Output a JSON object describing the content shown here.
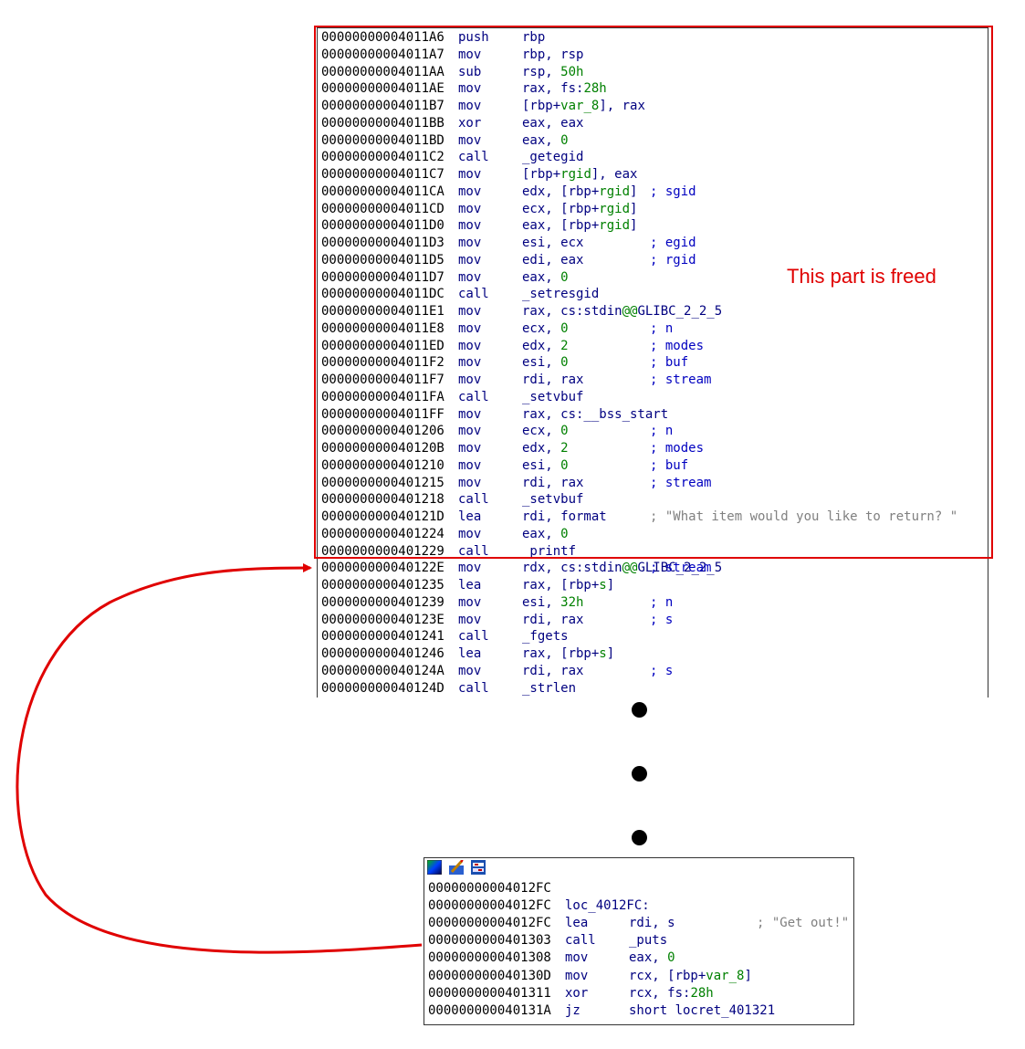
{
  "annotation": {
    "label": "This part is freed",
    "color": "#e00000"
  },
  "main_listing": [
    {
      "addr": "00000000004011A6",
      "mn": "push",
      "op": [
        {
          "t": "rbp"
        }
      ],
      "cm": ""
    },
    {
      "addr": "00000000004011A7",
      "mn": "mov",
      "op": [
        {
          "t": "rbp, rsp"
        }
      ],
      "cm": ""
    },
    {
      "addr": "00000000004011AA",
      "mn": "sub",
      "op": [
        {
          "t": "rsp, "
        },
        {
          "t": "50h",
          "c": "num"
        }
      ],
      "cm": ""
    },
    {
      "addr": "00000000004011AE",
      "mn": "mov",
      "op": [
        {
          "t": "rax, fs:"
        },
        {
          "t": "28h",
          "c": "num"
        }
      ],
      "cm": ""
    },
    {
      "addr": "00000000004011B7",
      "mn": "mov",
      "op": [
        {
          "t": "[rbp+"
        },
        {
          "t": "var_8",
          "c": "var"
        },
        {
          "t": "], rax"
        }
      ],
      "cm": ""
    },
    {
      "addr": "00000000004011BB",
      "mn": "xor",
      "op": [
        {
          "t": "eax, eax"
        }
      ],
      "cm": ""
    },
    {
      "addr": "00000000004011BD",
      "mn": "mov",
      "op": [
        {
          "t": "eax, "
        },
        {
          "t": "0",
          "c": "num"
        }
      ],
      "cm": ""
    },
    {
      "addr": "00000000004011C2",
      "mn": "call",
      "op": [
        {
          "t": "_getegid",
          "c": "fn"
        }
      ],
      "cm": ""
    },
    {
      "addr": "00000000004011C7",
      "mn": "mov",
      "op": [
        {
          "t": "[rbp+"
        },
        {
          "t": "rgid",
          "c": "var"
        },
        {
          "t": "], eax"
        }
      ],
      "cm": ""
    },
    {
      "addr": "00000000004011CA",
      "mn": "mov",
      "op": [
        {
          "t": "edx, [rbp+"
        },
        {
          "t": "rgid",
          "c": "var"
        },
        {
          "t": "] "
        }
      ],
      "cm": "; sgid"
    },
    {
      "addr": "00000000004011CD",
      "mn": "mov",
      "op": [
        {
          "t": "ecx, [rbp+"
        },
        {
          "t": "rgid",
          "c": "var"
        },
        {
          "t": "]"
        }
      ],
      "cm": ""
    },
    {
      "addr": "00000000004011D0",
      "mn": "mov",
      "op": [
        {
          "t": "eax, [rbp+"
        },
        {
          "t": "rgid",
          "c": "var"
        },
        {
          "t": "]"
        }
      ],
      "cm": ""
    },
    {
      "addr": "00000000004011D3",
      "mn": "mov",
      "op": [
        {
          "t": "esi, ecx"
        }
      ],
      "cm": "; egid"
    },
    {
      "addr": "00000000004011D5",
      "mn": "mov",
      "op": [
        {
          "t": "edi, eax"
        }
      ],
      "cm": "; rgid"
    },
    {
      "addr": "00000000004011D7",
      "mn": "mov",
      "op": [
        {
          "t": "eax, "
        },
        {
          "t": "0",
          "c": "num"
        }
      ],
      "cm": ""
    },
    {
      "addr": "00000000004011DC",
      "mn": "call",
      "op": [
        {
          "t": "_setresgid",
          "c": "fn"
        }
      ],
      "cm": ""
    },
    {
      "addr": "00000000004011E1",
      "mn": "mov",
      "op": [
        {
          "t": "rax, cs:stdin"
        },
        {
          "t": "@@",
          "c": "num"
        },
        {
          "t": "GLIBC_2_2_5"
        }
      ],
      "cm": ""
    },
    {
      "addr": "00000000004011E8",
      "mn": "mov",
      "op": [
        {
          "t": "ecx, "
        },
        {
          "t": "0",
          "c": "num"
        }
      ],
      "cm": "; n"
    },
    {
      "addr": "00000000004011ED",
      "mn": "mov",
      "op": [
        {
          "t": "edx, "
        },
        {
          "t": "2",
          "c": "num"
        }
      ],
      "cm": "; modes"
    },
    {
      "addr": "00000000004011F2",
      "mn": "mov",
      "op": [
        {
          "t": "esi, "
        },
        {
          "t": "0",
          "c": "num"
        }
      ],
      "cm": "; buf"
    },
    {
      "addr": "00000000004011F7",
      "mn": "mov",
      "op": [
        {
          "t": "rdi, rax"
        }
      ],
      "cm": "; stream"
    },
    {
      "addr": "00000000004011FA",
      "mn": "call",
      "op": [
        {
          "t": "_setvbuf",
          "c": "fn"
        }
      ],
      "cm": ""
    },
    {
      "addr": "00000000004011FF",
      "mn": "mov",
      "op": [
        {
          "t": "rax, cs:__bss_start"
        }
      ],
      "cm": ""
    },
    {
      "addr": "0000000000401206",
      "mn": "mov",
      "op": [
        {
          "t": "ecx, "
        },
        {
          "t": "0",
          "c": "num"
        }
      ],
      "cm": "; n"
    },
    {
      "addr": "000000000040120B",
      "mn": "mov",
      "op": [
        {
          "t": "edx, "
        },
        {
          "t": "2",
          "c": "num"
        }
      ],
      "cm": "; modes"
    },
    {
      "addr": "0000000000401210",
      "mn": "mov",
      "op": [
        {
          "t": "esi, "
        },
        {
          "t": "0",
          "c": "num"
        }
      ],
      "cm": "; buf"
    },
    {
      "addr": "0000000000401215",
      "mn": "mov",
      "op": [
        {
          "t": "rdi, rax"
        }
      ],
      "cm": "; stream"
    },
    {
      "addr": "0000000000401218",
      "mn": "call",
      "op": [
        {
          "t": "_setvbuf",
          "c": "fn"
        }
      ],
      "cm": ""
    },
    {
      "addr": "000000000040121D",
      "mn": "lea",
      "op": [
        {
          "t": "rdi, format"
        }
      ],
      "cm": "; \"What item would you like to return? \"",
      "cmstr": true
    },
    {
      "addr": "0000000000401224",
      "mn": "mov",
      "op": [
        {
          "t": "eax, "
        },
        {
          "t": "0",
          "c": "num"
        }
      ],
      "cm": ""
    },
    {
      "addr": "0000000000401229",
      "mn": "call",
      "op": [
        {
          "t": "_printf",
          "c": "fn"
        }
      ],
      "cm": ""
    },
    {
      "addr": "000000000040122E",
      "mn": "mov",
      "op": [
        {
          "t": "rdx, cs:stdin"
        },
        {
          "t": "@@",
          "c": "num"
        },
        {
          "t": "GLIBC_2_2_5 "
        }
      ],
      "cm": "; stream"
    },
    {
      "addr": "0000000000401235",
      "mn": "lea",
      "op": [
        {
          "t": "rax, [rbp+"
        },
        {
          "t": "s",
          "c": "var"
        },
        {
          "t": "]"
        }
      ],
      "cm": ""
    },
    {
      "addr": "0000000000401239",
      "mn": "mov",
      "op": [
        {
          "t": "esi, "
        },
        {
          "t": "32h",
          "c": "num"
        }
      ],
      "cm": "; n"
    },
    {
      "addr": "000000000040123E",
      "mn": "mov",
      "op": [
        {
          "t": "rdi, rax"
        }
      ],
      "cm": "; s"
    },
    {
      "addr": "0000000000401241",
      "mn": "call",
      "op": [
        {
          "t": "_fgets",
          "c": "fn"
        }
      ],
      "cm": ""
    },
    {
      "addr": "0000000000401246",
      "mn": "lea",
      "op": [
        {
          "t": "rax, [rbp+"
        },
        {
          "t": "s",
          "c": "var"
        },
        {
          "t": "]"
        }
      ],
      "cm": ""
    },
    {
      "addr": "000000000040124A",
      "mn": "mov",
      "op": [
        {
          "t": "rdi, rax"
        }
      ],
      "cm": "; s"
    },
    {
      "addr": "000000000040124D",
      "mn": "call",
      "op": [
        {
          "t": "_strlen",
          "c": "fn"
        }
      ],
      "cm": ""
    }
  ],
  "sub_listing": [
    {
      "addr": "00000000004012FC",
      "mn": "",
      "op": [],
      "cm": ""
    },
    {
      "addr": "00000000004012FC",
      "mn": "loc_4012FC:",
      "op": [],
      "cm": ""
    },
    {
      "addr": "00000000004012FC",
      "mn": "lea",
      "op": [
        {
          "t": "rdi, s"
        }
      ],
      "cm": "; \"Get out!\"",
      "cmstr": true
    },
    {
      "addr": "0000000000401303",
      "mn": "call",
      "op": [
        {
          "t": "_puts",
          "c": "fn"
        }
      ],
      "cm": ""
    },
    {
      "addr": "0000000000401308",
      "mn": "mov",
      "op": [
        {
          "t": "eax, "
        },
        {
          "t": "0",
          "c": "num"
        }
      ],
      "cm": ""
    },
    {
      "addr": "000000000040130D",
      "mn": "mov",
      "op": [
        {
          "t": "rcx, [rbp+"
        },
        {
          "t": "var_8",
          "c": "var"
        },
        {
          "t": "]"
        }
      ],
      "cm": ""
    },
    {
      "addr": "0000000000401311",
      "mn": "xor",
      "op": [
        {
          "t": "rcx, fs:"
        },
        {
          "t": "28h",
          "c": "num"
        }
      ],
      "cm": ""
    },
    {
      "addr": "000000000040131A",
      "mn": "jz",
      "op": [
        {
          "t": "short locret_401321"
        }
      ],
      "cm": ""
    }
  ],
  "toolbar_icons": [
    "graph-colors-icon",
    "edit-icon",
    "graph-view-icon"
  ]
}
